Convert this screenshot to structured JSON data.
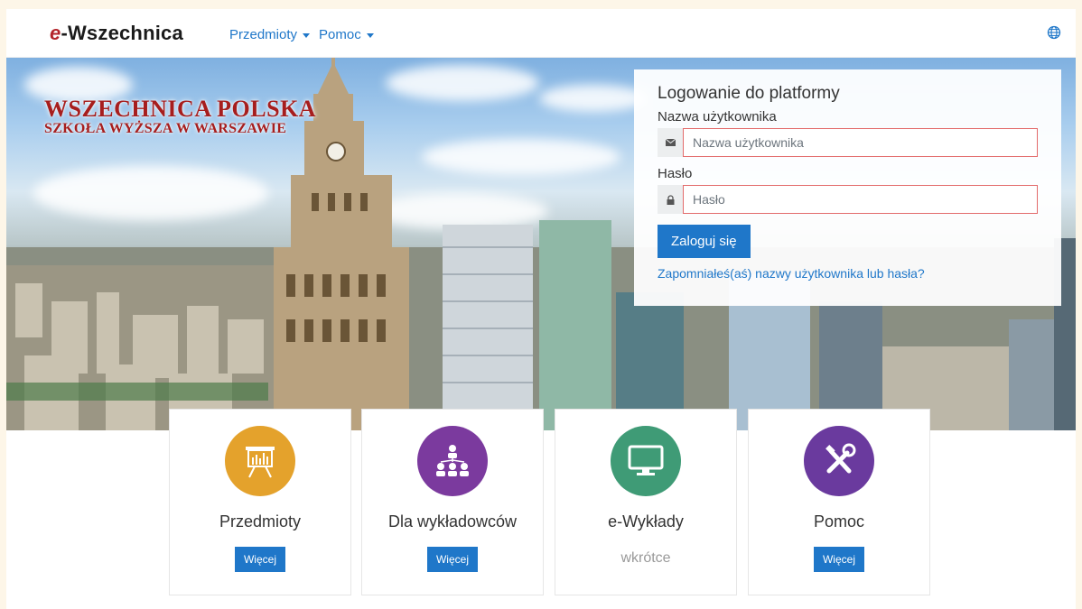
{
  "navbar": {
    "brand_prefix": "e",
    "brand_rest": "-Wszechnica",
    "menu": [
      "Przedmioty",
      "Pomoc"
    ]
  },
  "hero": {
    "logo_line1": "WSZECHNICA POLSKA",
    "logo_line2": "SZKOŁA WYŻSZA W WARSZAWIE"
  },
  "login": {
    "title": "Logowanie do platformy",
    "username_label": "Nazwa użytkownika",
    "username_placeholder": "Nazwa użytkownika",
    "password_label": "Hasło",
    "password_placeholder": "Hasło",
    "submit": "Zaloguj się",
    "forgot": "Zapomniałeś(aś) nazwy użytkownika lub hasła?"
  },
  "cards": [
    {
      "title": "Przedmioty",
      "action": "Więcej",
      "icon": "presentation-board-icon",
      "color": "#e4a22c"
    },
    {
      "title": "Dla wykładowców",
      "action": "Więcej",
      "icon": "people-network-icon",
      "color": "#7b3a9e"
    },
    {
      "title": "e-Wykłady",
      "status": "wkrótce",
      "icon": "monitor-icon",
      "color": "#3f9b76"
    },
    {
      "title": "Pomoc",
      "action": "Więcej",
      "icon": "tools-icon",
      "color": "#6a3a9e"
    }
  ],
  "colors": {
    "accent": "#1f77c9",
    "brand_red": "#b3232a",
    "error_border": "#e36b6b"
  }
}
